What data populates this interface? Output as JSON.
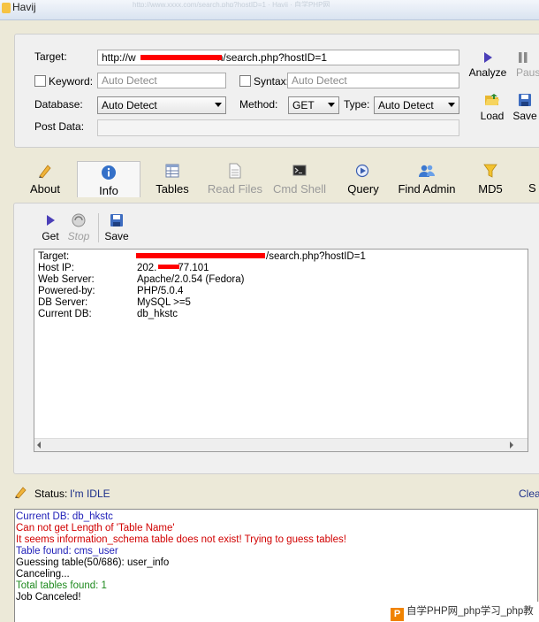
{
  "window": {
    "title": "Havij",
    "ghost_text": "http://www.xxxx.com/search.php?hostID=1 · Havij · 自学PHP网"
  },
  "form": {
    "target_label": "Target:",
    "target_value": "http://w",
    "target_value_suffix": "n/search.php?hostID=1",
    "keyword_label": "Keyword:",
    "keyword_placeholder": "Auto Detect",
    "syntax_label": "Syntax:",
    "syntax_placeholder": "Auto Detect",
    "database_label": "Database:",
    "database_value": "Auto Detect",
    "method_label": "Method:",
    "method_value": "GET",
    "type_label": "Type:",
    "type_value": "Auto Detect",
    "postdata_label": "Post Data:"
  },
  "actions": {
    "analyze": "Analyze",
    "pause": "Pause",
    "load": "Load",
    "save": "Save"
  },
  "tabs": [
    {
      "label": "About"
    },
    {
      "label": "Info"
    },
    {
      "label": "Tables"
    },
    {
      "label": "Read Files"
    },
    {
      "label": "Cmd Shell"
    },
    {
      "label": "Query"
    },
    {
      "label": "Find Admin"
    },
    {
      "label": "MD5"
    },
    {
      "label": "S"
    }
  ],
  "subtoolbar": {
    "get": "Get",
    "stop": "Stop",
    "save": "Save"
  },
  "info": [
    {
      "key": "Target:",
      "value": "/search.php?hostID=1"
    },
    {
      "key": "Host IP:",
      "value": "202.",
      "value_suffix": "77.101"
    },
    {
      "key": "Web Server:",
      "value": "Apache/2.0.54 (Fedora)"
    },
    {
      "key": "Powered-by:",
      "value": "PHP/5.0.4"
    },
    {
      "key": "DB Server:",
      "value": "MySQL >=5"
    },
    {
      "key": "Current DB:",
      "value": "db_hkstc"
    }
  ],
  "status": {
    "label": "Status:",
    "value": "I'm IDLE",
    "clear": "Clear"
  },
  "log": [
    {
      "text": "Current DB: db_hkstc",
      "color": "#1f1fb8"
    },
    {
      "text": "Can not get Length of 'Table Name'",
      "color": "#d10000"
    },
    {
      "text": "It seems information_schema table does not exist! Trying to guess tables!",
      "color": "#d10000"
    },
    {
      "text": "Table found: cms_user",
      "color": "#1f1fb8"
    },
    {
      "text": "Guessing table(50/686): user_info",
      "color": "#000000"
    },
    {
      "text": "Canceling...",
      "color": "#000000"
    },
    {
      "text": "Total tables found: 1",
      "color": "#1e8a1e"
    },
    {
      "text": "Job Canceled!",
      "color": "#000000"
    }
  ],
  "watermark": {
    "logo": "P",
    "text": "自学PHP网_php学习_php教"
  }
}
